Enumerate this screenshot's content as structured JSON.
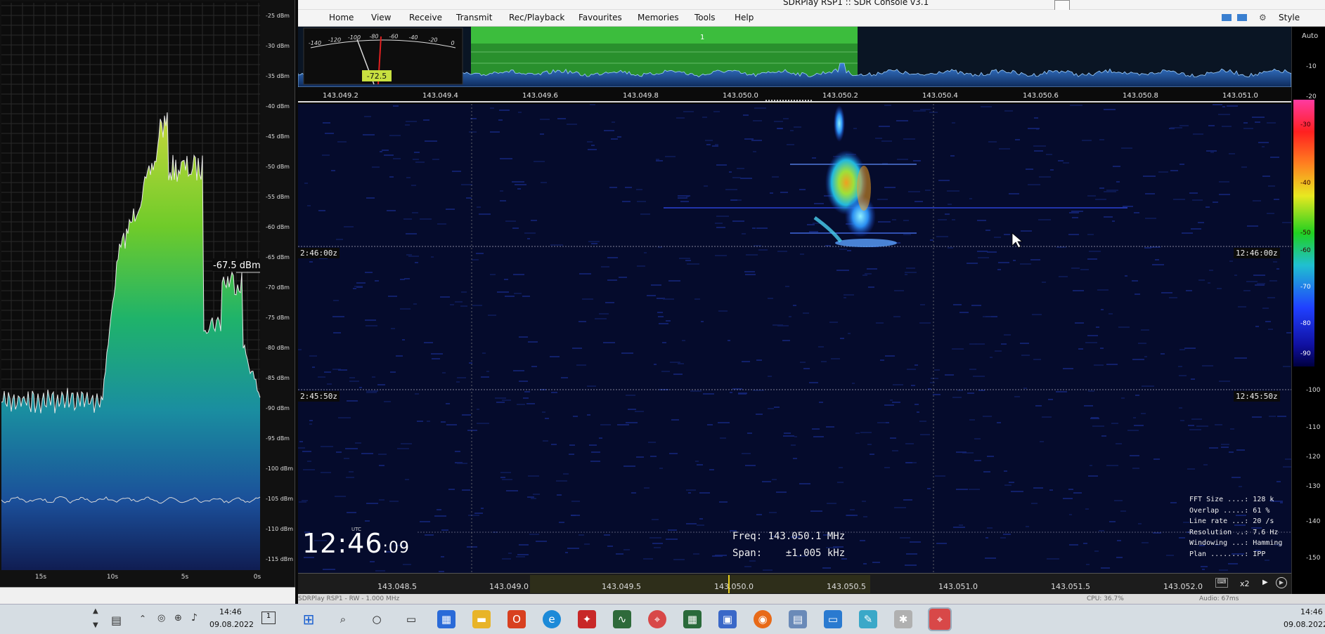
{
  "window": {
    "title": "SDRPlay RSP1 :: SDR Console v3.1"
  },
  "menu": [
    "Home",
    "View",
    "Receive",
    "Transmit",
    "Rec/Playback",
    "Favourites",
    "Memories",
    "Tools",
    "Help"
  ],
  "style_label": "Style",
  "smeter": {
    "scale": [
      "-140",
      "-120",
      "-100",
      "-80",
      "-60",
      "-40",
      "-20",
      "0"
    ],
    "value": "-72.5"
  },
  "vfo_marker": "1",
  "top_freqs": [
    "143.049.2",
    "143.049.4",
    "143.049.6",
    "143.049.8",
    "143.050.0",
    "143.050.2",
    "143.050.4",
    "143.050.6",
    "143.050.8",
    "143.051.0"
  ],
  "right_scale": {
    "auto": "Auto",
    "labels": [
      "-10",
      "-20",
      "-30",
      "-40",
      "-50",
      "-60",
      "-70",
      "-80",
      "-90",
      "-100",
      "-110",
      "-120",
      "-130",
      "-140",
      "-150"
    ]
  },
  "waterfall_times": {
    "upper_left": "2:46:00z",
    "upper_right": "12:46:00z",
    "lower_left": "2:45:50z",
    "lower_right": "12:45:50z"
  },
  "clock": {
    "utc": "UTC",
    "hm": "12:46",
    "sec": ":09"
  },
  "freq_info": {
    "freq": "Freq: 143.050.1 MHz",
    "span": "Span:    ±1.005 kHz"
  },
  "fft_info": [
    "FFT Size ....: 128 k",
    "Overlap .....: 61 %",
    "Line rate ...: 20 /s",
    "Resolution ..: 7.6 Hz",
    "Windowing ...: Hamming",
    "Plan ........: IPP"
  ],
  "bottom_freqs": [
    "143.048.5",
    "143.049.0",
    "143.049.5",
    "143.050.0",
    "143.050.5",
    "143.051.0",
    "143.051.5",
    "143.052.0"
  ],
  "zoom_label": "x2",
  "status_line": {
    "left": "SDRPlay RSP1 - RW - 1.000 MHz",
    "cpu": "CPU: 36.7%",
    "audio": "Audio: 67ms"
  },
  "left_panel": {
    "dbm_labels": [
      "-25 dBm",
      "-30 dBm",
      "-35 dBm",
      "-40 dBm",
      "-45 dBm",
      "-50 dBm",
      "-55 dBm",
      "-60 dBm",
      "-65 dBm",
      "-70 dBm",
      "-75 dBm",
      "-80 dBm",
      "-85 dBm",
      "-90 dBm",
      "-95 dBm",
      "-100 dBm",
      "-105 dBm",
      "-110 dBm",
      "-115 dBm"
    ],
    "time_labels": [
      "15s",
      "10s",
      "5s",
      "0s"
    ],
    "peak_label": "-67.5 dBm"
  },
  "tray_left": {
    "time": "14:46",
    "date": "09.08.2022"
  },
  "tray_right": {
    "time": "14:46",
    "date": "09.08.2022"
  },
  "colors": {
    "accent_green": "#22c022",
    "menu_bg": "#f4f4f4",
    "taskbar": "#d6dde3"
  }
}
